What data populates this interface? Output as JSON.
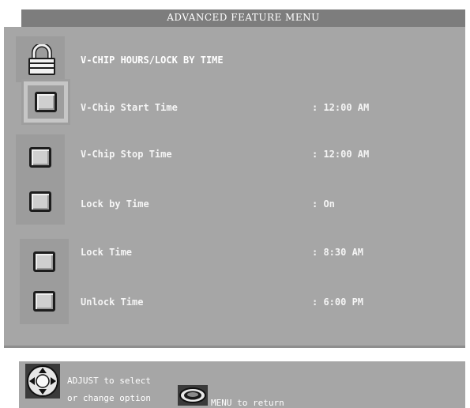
{
  "title": "ADVANCED FEATURE MENU",
  "header_row": {
    "label": "V-CHIP HOURS/LOCK BY TIME",
    "icon": "padlock-icon"
  },
  "rows": [
    {
      "label": "V-Chip Start Time",
      "value": ": 12:00 AM",
      "selected": true
    },
    {
      "label": "V-Chip Stop Time",
      "value": ": 12:00 AM",
      "selected": false
    },
    {
      "label": "Lock by Time",
      "value": ": On",
      "selected": false
    },
    {
      "label": "Lock Time",
      "value": ": 8:30 AM",
      "selected": false
    },
    {
      "label": "Unlock Time",
      "value": ": 6:00 PM",
      "selected": false
    }
  ],
  "help": {
    "line1": "ADJUST to select",
    "line2": "or change option",
    "line3": "MENU to return",
    "adjust_icon": "directional-pad-icon",
    "menu_icon": "menu-button-icon"
  },
  "colors": {
    "panel": "#a6a6a6",
    "title_bar": "#7d7d7d",
    "text": "#ffffff"
  }
}
